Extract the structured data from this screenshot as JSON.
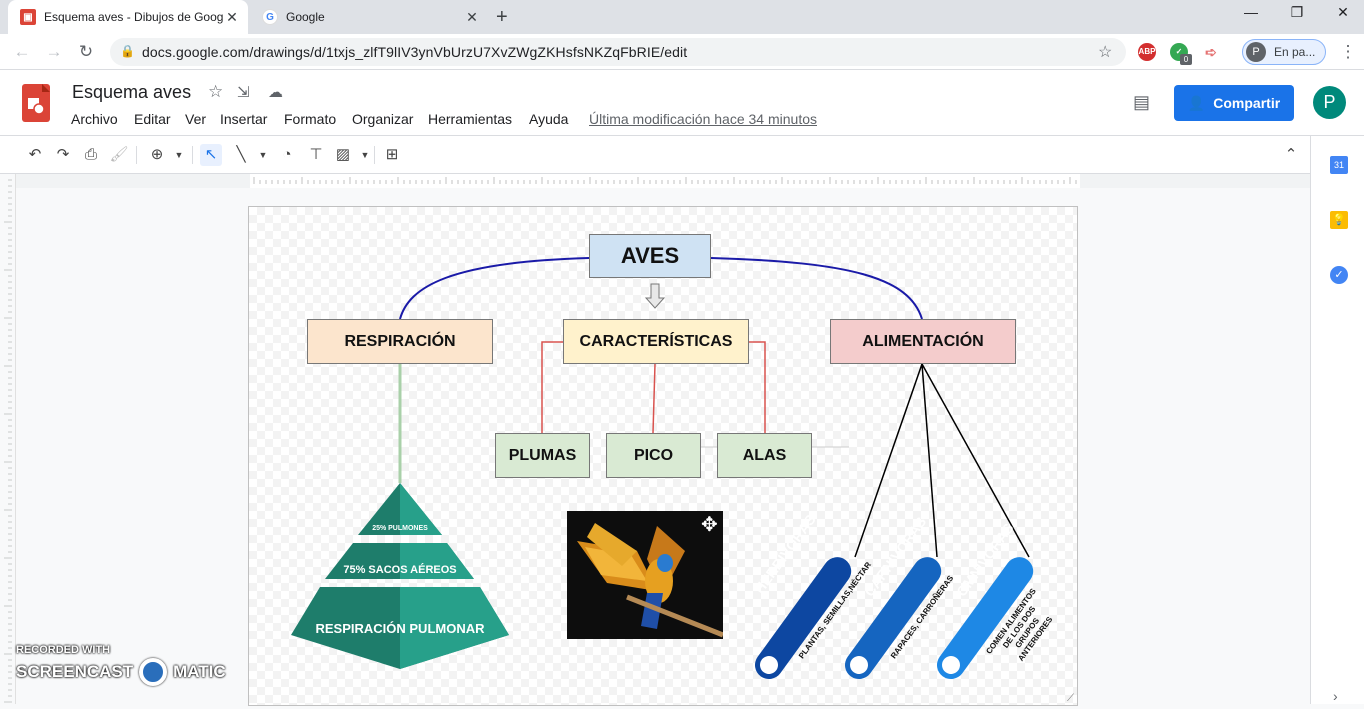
{
  "browser": {
    "tabs": [
      {
        "title": "Esquema aves - Dibujos de Goog",
        "favicon": "drawings-icon"
      },
      {
        "title": "Google",
        "favicon": "google-icon"
      }
    ],
    "url": "docs.google.com/drawings/d/1txjs_zlfT9lIV3ynVbUrzU7XvZWgZKHsfsNKZqFbRIE/edit",
    "profile_label": "En pa...",
    "profile_initial": "P",
    "ext_abp": "ABP",
    "ext_badge": "0"
  },
  "docs": {
    "title": "Esquema aves",
    "menu": [
      "Archivo",
      "Editar",
      "Ver",
      "Insertar",
      "Formato",
      "Organizar",
      "Herramientas",
      "Ayuda"
    ],
    "last_modified": "Última modificación hace 34 minutos",
    "share_label": "Compartir",
    "avatar_initial": "P",
    "calendar_day": "31"
  },
  "diagram": {
    "root": "AVES",
    "branches": [
      "RESPIRACIÓN",
      "CARACTERÍSTICAS",
      "ALIMENTACIÓN"
    ],
    "features": [
      "PLUMAS",
      "PICO",
      "ALAS"
    ],
    "pyramid": [
      "25% PULMONES",
      "75% SACOS AÉREOS",
      "RESPIRACIÓN PULMONAR"
    ],
    "diets": [
      {
        "name": "HERBÍVORAS",
        "desc": [
          "PLANTAS, SEMILLAS,NÉCTAR"
        ],
        "color": "#0d47a1"
      },
      {
        "name": "CARNÍVORAS",
        "desc": [
          "RAPACES, CARROÑERAS"
        ],
        "color": "#1565c0"
      },
      {
        "name": "OMNÍVORAS",
        "desc": [
          "COMEN ALIMENTOS",
          "DE LOS DOS",
          "GRUPOS",
          "ANTERIORES"
        ],
        "color": "#1e88e5"
      }
    ],
    "colors": {
      "root_fill": "#cfe2f3",
      "resp_fill": "#fce5cd",
      "car_fill": "#fff2cc",
      "ali_fill": "#f4cccc",
      "feature_fill": "#d9ead3",
      "arc": "#1a1aa8",
      "connector": "#d9534f",
      "pyramid": "#1e7d6b"
    }
  },
  "watermark": {
    "line1": "RECORDED WITH",
    "line2a": "SCREENCAST",
    "line2b": "MATIC"
  }
}
